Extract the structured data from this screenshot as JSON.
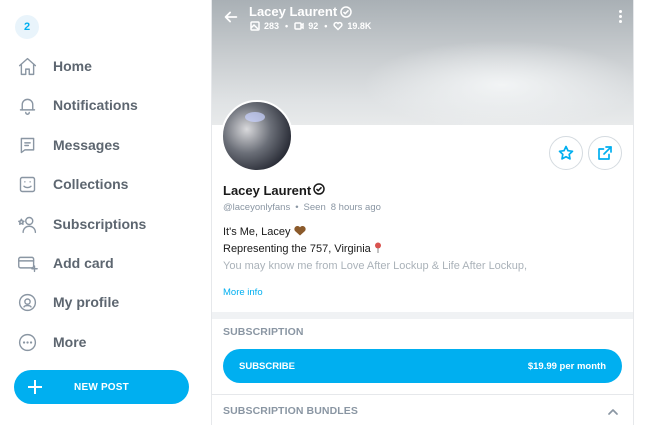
{
  "sidebar": {
    "avatar_initial": "2",
    "items": [
      {
        "label": "Home",
        "icon": "home-icon"
      },
      {
        "label": "Notifications",
        "icon": "bell-icon"
      },
      {
        "label": "Messages",
        "icon": "message-icon"
      },
      {
        "label": "Collections",
        "icon": "bookmark-icon"
      },
      {
        "label": "Subscriptions",
        "icon": "user-star-icon"
      },
      {
        "label": "Add card",
        "icon": "card-add-icon"
      },
      {
        "label": "My profile",
        "icon": "profile-icon"
      },
      {
        "label": "More",
        "icon": "more-circle-icon"
      }
    ],
    "new_post_label": "NEW POST"
  },
  "header": {
    "name": "Lacey Laurent",
    "stats": {
      "photos": "283",
      "videos": "92",
      "likes": "19.8K"
    }
  },
  "profile": {
    "name": "Lacey Laurent",
    "handle": "@laceyonlyfans",
    "seen_label": "Seen",
    "seen_time": "8 hours ago",
    "bio_line1": "It's Me, Lacey",
    "bio_line2": "Representing the 757, Virginia",
    "bio_line3": "You may know me from Love After Lockup & Life After Lockup,",
    "more_info": "More info"
  },
  "subscription": {
    "title": "SUBSCRIPTION",
    "button_label": "SUBSCRIBE",
    "price": "$19.99 per month",
    "bundles_title": "SUBSCRIPTION BUNDLES"
  },
  "colors": {
    "accent": "#00aff0",
    "muted": "#8a96a3"
  }
}
